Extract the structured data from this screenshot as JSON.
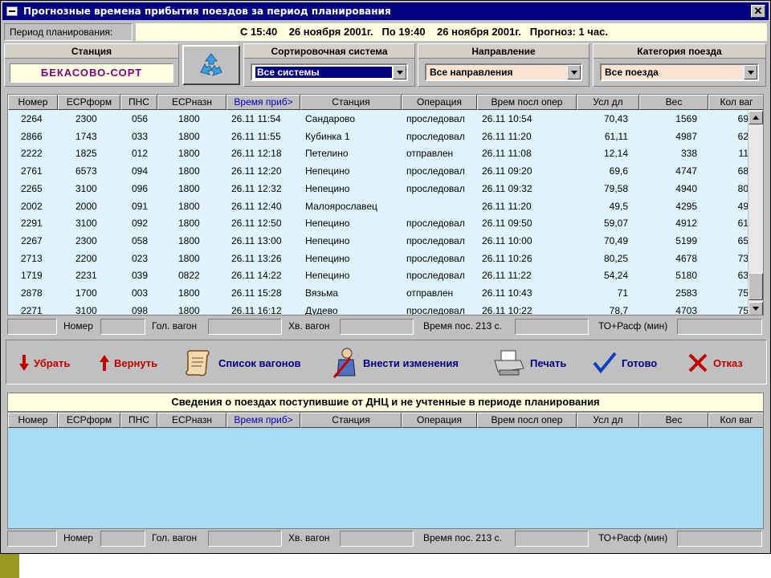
{
  "window": {
    "title": "Прогнозные времена прибытия поездов за период планирования",
    "close_glyph": "✕"
  },
  "period": {
    "label": "Период планирования:",
    "value": "С 15:40    26 ноября 2001г.   По 19:40    26 ноября 2001г.   Прогноз: 1 час."
  },
  "station": {
    "label": "Станция",
    "value": "БЕКАСОВО-СОРТ"
  },
  "sort_system": {
    "label": "Сортировочная система",
    "selected": "Все системы"
  },
  "direction": {
    "label": "Направление",
    "selected": "Все направления"
  },
  "category": {
    "label": "Категория поезда",
    "selected": "Все поезда"
  },
  "columns": [
    "Номер",
    "ЕСРформ",
    "ПНС",
    "ЕСРназн",
    "Время приб>",
    "Станция",
    "Операция",
    "Врем посл опер",
    "Усл дл",
    "Вес",
    "Кол ваг"
  ],
  "columns_bottom": [
    "Номер",
    "ЕСРформ",
    "ПНС",
    "ЕСРназн",
    "Время приб>",
    "Станция",
    "Операция",
    "Врем посл опер",
    "Усл дл",
    "Вес",
    "Кол ваг"
  ],
  "trains": [
    [
      "2264",
      "2300",
      "056",
      "1800",
      "26.11 11:54",
      "Сандарово",
      "проследовал",
      "26.11 10:54",
      "70,43",
      "1569",
      "69"
    ],
    [
      "2866",
      "1743",
      "033",
      "1800",
      "26.11 11:55",
      "Кубинка 1",
      "проследовал",
      "26.11 11:20",
      "61,11",
      "4987",
      "62"
    ],
    [
      "2222",
      "1825",
      "012",
      "1800",
      "26.11 12:18",
      "Петелино",
      "отправлен",
      "26.11 11:08",
      "12,14",
      "338",
      "11"
    ],
    [
      "2761",
      "6573",
      "094",
      "1800",
      "26.11 12:20",
      "Непецино",
      "проследовал",
      "26.11 09:20",
      "69,6",
      "4747",
      "68"
    ],
    [
      "2265",
      "3100",
      "096",
      "1800",
      "26.11 12:32",
      "Непецино",
      "проследовал",
      "26.11 09:32",
      "79,58",
      "4940",
      "80"
    ],
    [
      "2002",
      "2000",
      "091",
      "1800",
      "26.11 12:40",
      "Малоярославец",
      "",
      "26.11 11:20",
      "49,5",
      "4295",
      "49"
    ],
    [
      "2291",
      "3100",
      "092",
      "1800",
      "26.11 12:50",
      "Непецино",
      "проследовал",
      "26.11 09:50",
      "59,07",
      "4912",
      "61"
    ],
    [
      "2267",
      "2300",
      "058",
      "1800",
      "26.11 13:00",
      "Непецино",
      "проследовал",
      "26.11 10:00",
      "70,49",
      "5199",
      "65"
    ],
    [
      "2713",
      "2200",
      "023",
      "1800",
      "26.11 13:26",
      "Непецино",
      "проследовал",
      "26.11 10:26",
      "80,25",
      "4678",
      "73"
    ],
    [
      "1719",
      "2231",
      "039",
      "0822",
      "26.11 14:22",
      "Непецино",
      "проследовал",
      "26.11 11:22",
      "54,24",
      "5180",
      "63"
    ],
    [
      "2878",
      "1700",
      "003",
      "1800",
      "26.11 15:28",
      "Вязьма",
      "отправлен",
      "26.11 10:43",
      "71",
      "2583",
      "75"
    ],
    [
      "2271",
      "3100",
      "098",
      "1800",
      "26.11 16:12",
      "Дудево",
      "проследовал",
      "26.11 10:22",
      "78,7",
      "4703",
      "75"
    ]
  ],
  "status_bar": {
    "number": "Номер",
    "head_wagon": "Гол. вагон",
    "tail_wagon": "Хв. вагон",
    "time_pos": "Время пос. 213 с.",
    "to_rasf": "ТО+Расф (мин)"
  },
  "toolbar": {
    "remove": "Убрать",
    "restore": "Вернуть",
    "wagon_list": "Список вагонов",
    "apply_changes": "Внести изменения",
    "print": "Печать",
    "done": "Готово",
    "cancel": "Отказ"
  },
  "dnc_section": {
    "title": "Сведения о поездах поступившие от ДНЦ и не учтенные в периоде планирования"
  },
  "colors": {
    "titlebar": "#000080",
    "grid_bg": "#dff4fc",
    "dnc_grid_bg": "#a8dcf4",
    "highlight_yellow": "#ffffe1",
    "station_text": "#800080"
  }
}
